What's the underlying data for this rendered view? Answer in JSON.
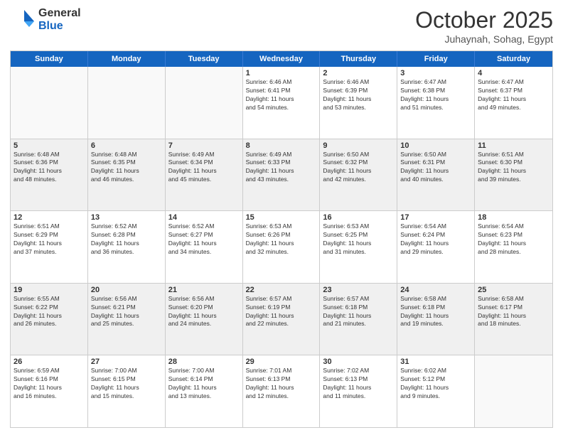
{
  "logo": {
    "general": "General",
    "blue": "Blue"
  },
  "header": {
    "month": "October 2025",
    "location": "Juhaynah, Sohag, Egypt"
  },
  "dayHeaders": [
    "Sunday",
    "Monday",
    "Tuesday",
    "Wednesday",
    "Thursday",
    "Friday",
    "Saturday"
  ],
  "weeks": [
    [
      {
        "num": "",
        "info": "",
        "empty": true
      },
      {
        "num": "",
        "info": "",
        "empty": true
      },
      {
        "num": "",
        "info": "",
        "empty": true
      },
      {
        "num": "1",
        "info": "Sunrise: 6:46 AM\nSunset: 6:41 PM\nDaylight: 11 hours\nand 54 minutes."
      },
      {
        "num": "2",
        "info": "Sunrise: 6:46 AM\nSunset: 6:39 PM\nDaylight: 11 hours\nand 53 minutes."
      },
      {
        "num": "3",
        "info": "Sunrise: 6:47 AM\nSunset: 6:38 PM\nDaylight: 11 hours\nand 51 minutes."
      },
      {
        "num": "4",
        "info": "Sunrise: 6:47 AM\nSunset: 6:37 PM\nDaylight: 11 hours\nand 49 minutes."
      }
    ],
    [
      {
        "num": "5",
        "info": "Sunrise: 6:48 AM\nSunset: 6:36 PM\nDaylight: 11 hours\nand 48 minutes."
      },
      {
        "num": "6",
        "info": "Sunrise: 6:48 AM\nSunset: 6:35 PM\nDaylight: 11 hours\nand 46 minutes."
      },
      {
        "num": "7",
        "info": "Sunrise: 6:49 AM\nSunset: 6:34 PM\nDaylight: 11 hours\nand 45 minutes."
      },
      {
        "num": "8",
        "info": "Sunrise: 6:49 AM\nSunset: 6:33 PM\nDaylight: 11 hours\nand 43 minutes."
      },
      {
        "num": "9",
        "info": "Sunrise: 6:50 AM\nSunset: 6:32 PM\nDaylight: 11 hours\nand 42 minutes."
      },
      {
        "num": "10",
        "info": "Sunrise: 6:50 AM\nSunset: 6:31 PM\nDaylight: 11 hours\nand 40 minutes."
      },
      {
        "num": "11",
        "info": "Sunrise: 6:51 AM\nSunset: 6:30 PM\nDaylight: 11 hours\nand 39 minutes."
      }
    ],
    [
      {
        "num": "12",
        "info": "Sunrise: 6:51 AM\nSunset: 6:29 PM\nDaylight: 11 hours\nand 37 minutes."
      },
      {
        "num": "13",
        "info": "Sunrise: 6:52 AM\nSunset: 6:28 PM\nDaylight: 11 hours\nand 36 minutes."
      },
      {
        "num": "14",
        "info": "Sunrise: 6:52 AM\nSunset: 6:27 PM\nDaylight: 11 hours\nand 34 minutes."
      },
      {
        "num": "15",
        "info": "Sunrise: 6:53 AM\nSunset: 6:26 PM\nDaylight: 11 hours\nand 32 minutes."
      },
      {
        "num": "16",
        "info": "Sunrise: 6:53 AM\nSunset: 6:25 PM\nDaylight: 11 hours\nand 31 minutes."
      },
      {
        "num": "17",
        "info": "Sunrise: 6:54 AM\nSunset: 6:24 PM\nDaylight: 11 hours\nand 29 minutes."
      },
      {
        "num": "18",
        "info": "Sunrise: 6:54 AM\nSunset: 6:23 PM\nDaylight: 11 hours\nand 28 minutes."
      }
    ],
    [
      {
        "num": "19",
        "info": "Sunrise: 6:55 AM\nSunset: 6:22 PM\nDaylight: 11 hours\nand 26 minutes."
      },
      {
        "num": "20",
        "info": "Sunrise: 6:56 AM\nSunset: 6:21 PM\nDaylight: 11 hours\nand 25 minutes."
      },
      {
        "num": "21",
        "info": "Sunrise: 6:56 AM\nSunset: 6:20 PM\nDaylight: 11 hours\nand 24 minutes."
      },
      {
        "num": "22",
        "info": "Sunrise: 6:57 AM\nSunset: 6:19 PM\nDaylight: 11 hours\nand 22 minutes."
      },
      {
        "num": "23",
        "info": "Sunrise: 6:57 AM\nSunset: 6:18 PM\nDaylight: 11 hours\nand 21 minutes."
      },
      {
        "num": "24",
        "info": "Sunrise: 6:58 AM\nSunset: 6:18 PM\nDaylight: 11 hours\nand 19 minutes."
      },
      {
        "num": "25",
        "info": "Sunrise: 6:58 AM\nSunset: 6:17 PM\nDaylight: 11 hours\nand 18 minutes."
      }
    ],
    [
      {
        "num": "26",
        "info": "Sunrise: 6:59 AM\nSunset: 6:16 PM\nDaylight: 11 hours\nand 16 minutes."
      },
      {
        "num": "27",
        "info": "Sunrise: 7:00 AM\nSunset: 6:15 PM\nDaylight: 11 hours\nand 15 minutes."
      },
      {
        "num": "28",
        "info": "Sunrise: 7:00 AM\nSunset: 6:14 PM\nDaylight: 11 hours\nand 13 minutes."
      },
      {
        "num": "29",
        "info": "Sunrise: 7:01 AM\nSunset: 6:13 PM\nDaylight: 11 hours\nand 12 minutes."
      },
      {
        "num": "30",
        "info": "Sunrise: 7:02 AM\nSunset: 6:13 PM\nDaylight: 11 hours\nand 11 minutes."
      },
      {
        "num": "31",
        "info": "Sunrise: 6:02 AM\nSunset: 5:12 PM\nDaylight: 11 hours\nand 9 minutes."
      },
      {
        "num": "",
        "info": "",
        "empty": true
      }
    ]
  ]
}
